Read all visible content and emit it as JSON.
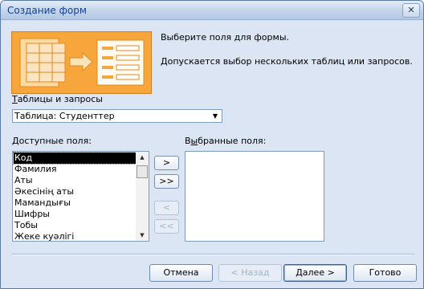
{
  "window": {
    "title": "Создание форм",
    "close_glyph": "✕"
  },
  "info": {
    "line1": "Выберите поля для формы.",
    "line2": "Допускается выбор нескольких таблиц или запросов."
  },
  "source": {
    "label_hotkey": "Т",
    "label_rest": "аблицы и запросы",
    "selected": "Таблица: Студенттер"
  },
  "available": {
    "label_hotkey": "Д",
    "label_rest": "оступные поля:",
    "items": [
      "Код",
      "Фамилия",
      "Аты",
      "Әкесінің аты",
      "Мамандығы",
      "Шифры",
      "Тобы",
      "Жеке куәлігі"
    ],
    "selected_index": 0
  },
  "selected_fields": {
    "label_pre": "В",
    "label_hotkey": "ы",
    "label_rest": "бранные поля:"
  },
  "move_buttons": {
    "add_one": ">",
    "add_all": ">>",
    "remove_one": "<",
    "remove_all": "<<"
  },
  "buttons": {
    "cancel": "Отмена",
    "back": "< Назад",
    "next": "Далее >",
    "finish": "Готово"
  },
  "icons": {
    "combo_arrow": "▼",
    "scroll_up": "▲",
    "scroll_down": "▼"
  }
}
